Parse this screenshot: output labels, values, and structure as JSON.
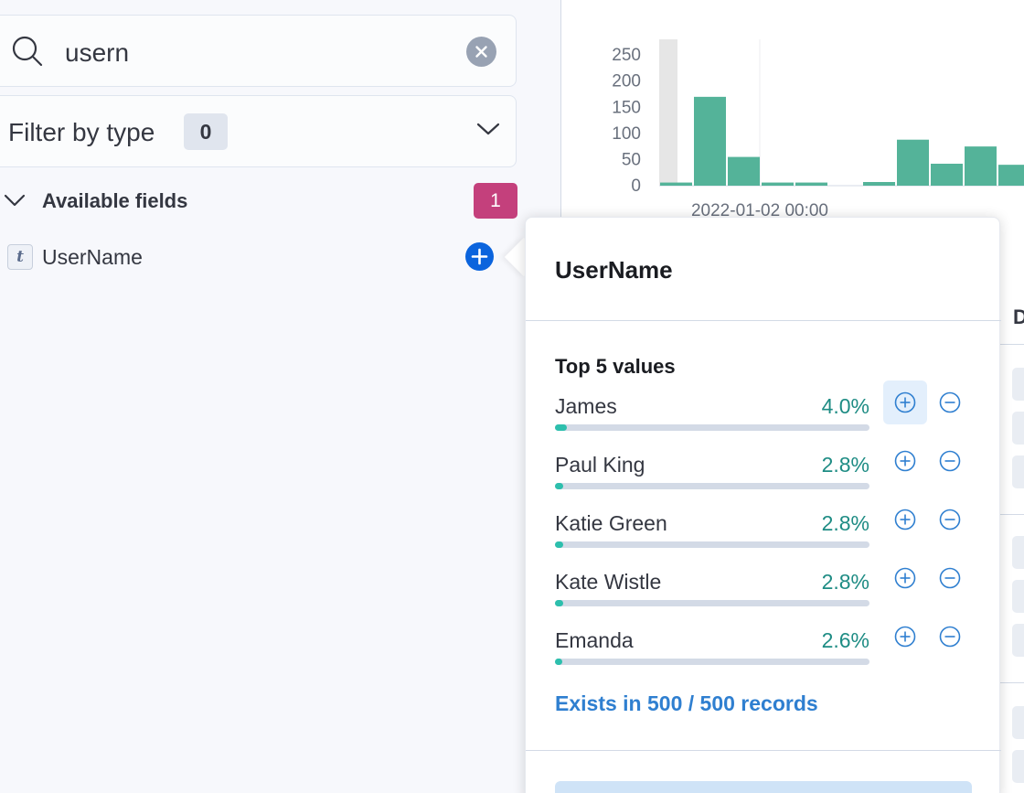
{
  "search": {
    "value": "usern",
    "icon": "magnifier-icon"
  },
  "filter_by_type": {
    "label": "Filter by type",
    "count": "0"
  },
  "available_fields": {
    "label": "Available fields",
    "count": "1"
  },
  "fields": [
    {
      "type_token": "t",
      "name": "UserName"
    }
  ],
  "chart_data": {
    "type": "bar",
    "y_ticks": [
      "250",
      "200",
      "150",
      "100",
      "50",
      "0"
    ],
    "ylim": [
      0,
      280
    ],
    "x_tick_label": "2022-01-02 00:00",
    "values": [
      6,
      170,
      55,
      6,
      6,
      0,
      7,
      88,
      42,
      75,
      40
    ],
    "color": "#54b399"
  },
  "popover": {
    "title": "UserName",
    "section_title": "Top 5 values",
    "values": [
      {
        "name": "James",
        "percent": "4.0%",
        "fraction": 0.04
      },
      {
        "name": "Paul King",
        "percent": "2.8%",
        "fraction": 0.028
      },
      {
        "name": "Katie Green",
        "percent": "2.8%",
        "fraction": 0.028
      },
      {
        "name": "Kate Wistle",
        "percent": "2.8%",
        "fraction": 0.028
      },
      {
        "name": "Emanda",
        "percent": "2.6%",
        "fraction": 0.026
      }
    ],
    "exists_text": "Exists in 500 / 500 records"
  },
  "right_panel": {
    "column_header_partial": "D"
  },
  "colors": {
    "accent": "#0b64dd",
    "badge": "#c4407c",
    "percent_text": "#1e8c84",
    "bar_fill": "#2dbfad",
    "link": "#2f7fd0"
  }
}
